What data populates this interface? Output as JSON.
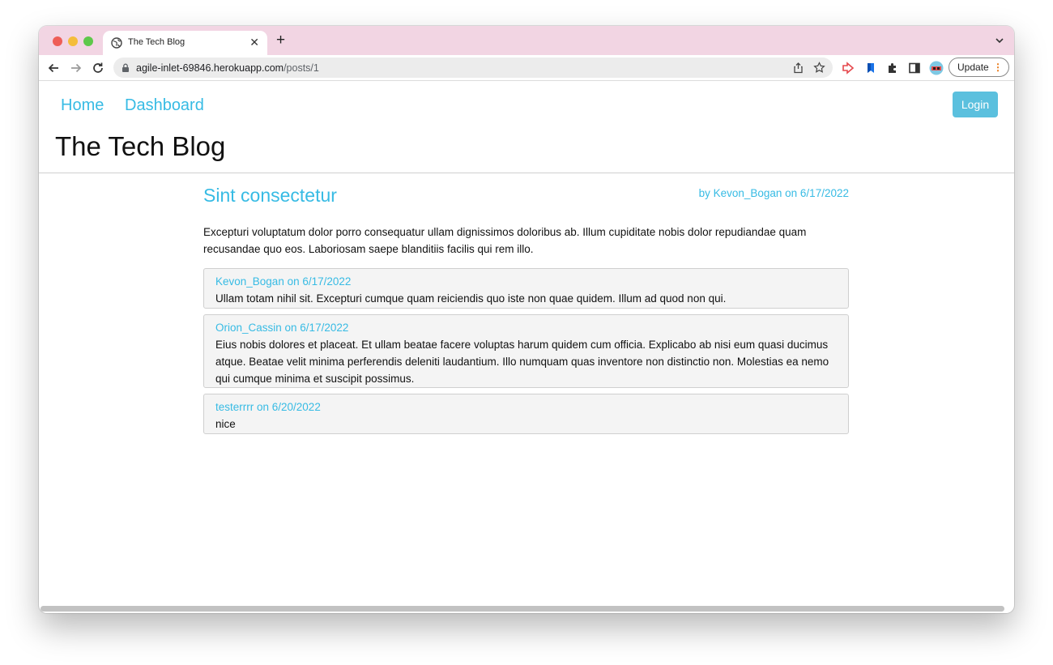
{
  "browser": {
    "tab_title": "The Tech Blog",
    "url_host": "agile-inlet-69846.herokuapp.com",
    "url_path": "/posts/1",
    "update_label": "Update"
  },
  "nav": {
    "links": [
      {
        "label": "Home"
      },
      {
        "label": "Dashboard"
      }
    ],
    "login_label": "Login"
  },
  "site_title": "The Tech Blog",
  "post": {
    "title": "Sint consectetur",
    "meta": "by Kevon_Bogan on 6/17/2022",
    "body": "Excepturi voluptatum dolor porro consequatur ullam dignissimos doloribus ab. Illum cupiditate nobis dolor repudiandae quam recusandae quo eos. Laboriosam saepe blanditiis facilis qui rem illo."
  },
  "comments": [
    {
      "meta": "Kevon_Bogan on 6/17/2022",
      "text": "Ullam totam nihil sit. Excepturi cumque quam reiciendis quo iste non quae quidem. Illum ad quod non qui."
    },
    {
      "meta": "Orion_Cassin on 6/17/2022",
      "text": "Eius nobis dolores et placeat. Et ullam beatae facere voluptas harum quidem cum officia. Explicabo ab nisi eum quasi ducimus atque. Beatae velit minima perferendis deleniti laudantium. Illo numquam quas inventore non distinctio non. Molestias ea nemo qui cumque minima et suscipit possimus."
    },
    {
      "meta": "testerrrr on 6/20/2022",
      "text": "nice"
    }
  ],
  "colors": {
    "accent": "#37bbe4",
    "login_button": "#5bc0de",
    "tab_strip": "#f2d5e3",
    "comment_bg": "#f4f4f4"
  }
}
